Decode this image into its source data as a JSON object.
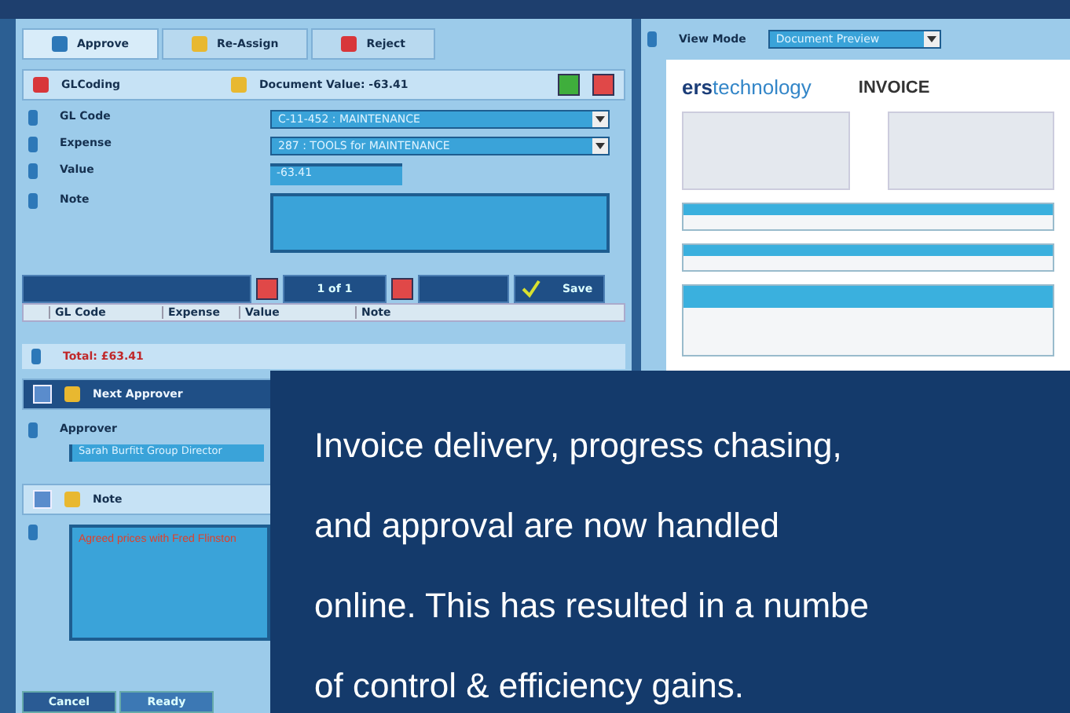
{
  "tabs": [
    {
      "label": "Approve",
      "selected": true
    },
    {
      "label": "Re-Assign",
      "selected": false
    },
    {
      "label": "Reject",
      "selected": false
    }
  ],
  "gl_header": {
    "title": "GLCoding",
    "document_value": "Document Value: -63.41"
  },
  "fields": [
    {
      "label": "GL Code",
      "kind": "dropdown",
      "value": "C-11-452 : MAINTENANCE"
    },
    {
      "label": "Expense",
      "kind": "dropdown",
      "value": "287 : TOOLS for MAINTENANCE"
    },
    {
      "label": "Value",
      "kind": "text",
      "value": "-63.41"
    },
    {
      "label": "Note",
      "kind": "area"
    }
  ],
  "pager": {
    "page": "1 of 1",
    "save": "Save"
  },
  "table": {
    "columns": [
      "GL Code",
      "Expense",
      "Value",
      "Note"
    ]
  },
  "total": "Total: £63.41",
  "next_approver": {
    "title": "Next Approver",
    "label": "Approver",
    "value": "Sarah Burfitt Group Director"
  },
  "note": {
    "title": "Note",
    "value": "Agreed prices with Fred Flinston"
  },
  "bottom_tabs": [
    {
      "label": "Cancel",
      "selected": true
    },
    {
      "label": "Ready",
      "selected": false
    }
  ],
  "view_mode": {
    "label": "View Mode",
    "value": "Document Preview"
  },
  "document": {
    "logo": "ers",
    "logo_rest": "technology",
    "title": "INVOICE"
  },
  "caption": "Invoice delivery, progress chasing,\nand approval are now handled\nonline. This has resulted in a numbe\nof control & efficiency gains."
}
